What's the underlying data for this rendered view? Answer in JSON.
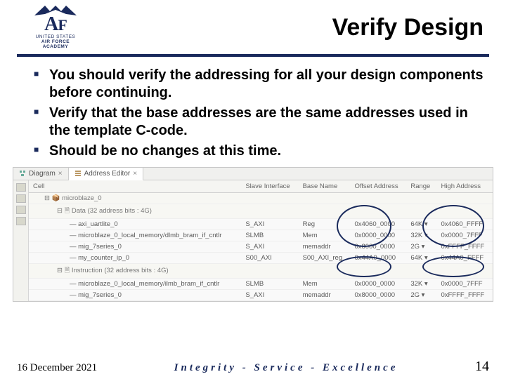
{
  "header": {
    "logo_sub1": "UNITED STATES",
    "logo_sub2": "AIR FORCE",
    "logo_sub3": "ACADEMY",
    "title": "Verify Design"
  },
  "bullets": [
    "You should verify the addressing for all your design components before continuing.",
    "Verify that the base addresses are the same addresses used in the template C-code.",
    "Should be no changes at this time."
  ],
  "tabs": {
    "diagram": "Diagram",
    "address": "Address Editor"
  },
  "table": {
    "headers": [
      "Cell",
      "Slave Interface",
      "Base Name",
      "Offset Address",
      "Range",
      "High Address"
    ],
    "rows": [
      {
        "type": "root",
        "cell": "microblaze_0"
      },
      {
        "type": "group",
        "cell": "Data (32 address bits : 4G)"
      },
      {
        "type": "leaf",
        "cell": "axi_uartlite_0",
        "iface": "S_AXI",
        "base": "Reg",
        "offset": "0x4060_0000",
        "range": "64K",
        "high": "0x4060_FFFF"
      },
      {
        "type": "leaf",
        "cell": "microblaze_0_local_memory/dlmb_bram_if_cntlr",
        "iface": "SLMB",
        "base": "Mem",
        "offset": "0x0000_0000",
        "range": "32K",
        "high": "0x0000_7FFF"
      },
      {
        "type": "leaf",
        "cell": "mig_7series_0",
        "iface": "S_AXI",
        "base": "memaddr",
        "offset": "0x8000_0000",
        "range": "2G",
        "high": "0xFFFF_FFFF"
      },
      {
        "type": "leaf",
        "cell": "my_counter_ip_0",
        "iface": "S00_AXI",
        "base": "S00_AXI_reg",
        "offset": "0x44A0_0000",
        "range": "64K",
        "high": "0x44A0_FFFF"
      },
      {
        "type": "group",
        "cell": "Instruction (32 address bits : 4G)"
      },
      {
        "type": "leaf",
        "cell": "microblaze_0_local_memory/ilmb_bram_if_cntlr",
        "iface": "SLMB",
        "base": "Mem",
        "offset": "0x0000_0000",
        "range": "32K",
        "high": "0x0000_7FFF"
      },
      {
        "type": "leaf",
        "cell": "mig_7series_0",
        "iface": "S_AXI",
        "base": "memaddr",
        "offset": "0x8000_0000",
        "range": "2G",
        "high": "0xFFFF_FFFF"
      }
    ]
  },
  "footer": {
    "date": "16 December 2021",
    "motto": "Integrity - Service - Excellence",
    "page": "14"
  }
}
